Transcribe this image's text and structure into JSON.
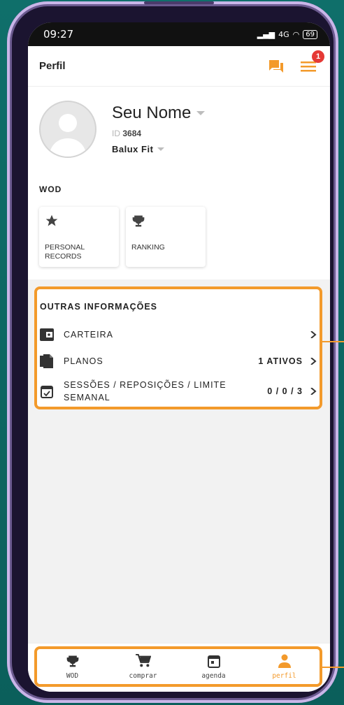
{
  "status_bar": {
    "time": "09:27",
    "network": "4G",
    "battery": "69"
  },
  "header": {
    "title": "Perfil",
    "notification_count": "1"
  },
  "profile": {
    "name": "Seu Nome",
    "id_label": "ID",
    "id_value": "3684",
    "gym": "Balux Fit"
  },
  "wod": {
    "section_title": "WOD",
    "cards": [
      {
        "label": "PERSONAL RECORDS",
        "icon": "star-icon"
      },
      {
        "label": "RANKING",
        "icon": "trophy-icon"
      }
    ]
  },
  "info": {
    "title": "OUTRAS INFORMAÇÕES",
    "rows": [
      {
        "label": "CARTEIRA",
        "value": "",
        "icon": "wallet-icon"
      },
      {
        "label": "PLANOS",
        "value": "1 ATIVOS",
        "icon": "documents-icon"
      },
      {
        "label": "SESSÕES / REPOSIÇÕES / LIMITE SEMANAL",
        "value": "0 / 0 / 3",
        "icon": "calendar-check-icon"
      }
    ]
  },
  "nav": {
    "items": [
      {
        "label": "WOD",
        "icon": "trophy-icon",
        "active": false
      },
      {
        "label": "comprar",
        "icon": "cart-icon",
        "active": false
      },
      {
        "label": "agenda",
        "icon": "calendar-icon",
        "active": false
      },
      {
        "label": "perfil",
        "icon": "person-icon",
        "active": true
      }
    ]
  },
  "colors": {
    "accent": "#f39a2b",
    "badge": "#e53935"
  }
}
